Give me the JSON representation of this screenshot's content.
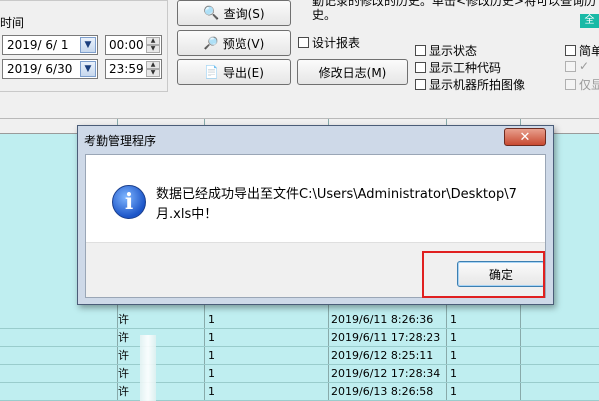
{
  "toolbar": {
    "period_label": "时间",
    "start_date": "2019/ 6/ 1",
    "end_date": "2019/ 6/30",
    "start_time": "00:00",
    "end_time": "23:59",
    "query_btn": "查询(S)",
    "preview_btn": "预览(V)",
    "export_btn": "导出(E)",
    "modlog_btn": "修改日志(M)",
    "design_report": "设计报表",
    "desc_text": "勤记录的修改的历史。单击<修改历史>将可以查询历史。",
    "show_status": "显示状态",
    "show_worktype": "显示工种代码",
    "show_photo": "显示机器所拍图像",
    "simple_mode": "简单",
    "option_all": "全",
    "option_only": "仅显"
  },
  "rows": [
    {
      "name": "许",
      "n": "1",
      "time": "2019/6/11  8:26:36",
      "v": "1"
    },
    {
      "name": "许",
      "n": "1",
      "time": "2019/6/11  17:28:23",
      "v": "1"
    },
    {
      "name": "许",
      "n": "1",
      "time": "2019/6/12  8:25:11",
      "v": "1"
    },
    {
      "name": "许",
      "n": "1",
      "time": "2019/6/12  17:28:34",
      "v": "1"
    },
    {
      "name": "许",
      "n": "1",
      "time": "2019/6/13  8:26:58",
      "v": "1"
    }
  ],
  "dialog": {
    "title": "考勤管理程序",
    "close": "✕",
    "message": "数据已经成功导出至文件C:\\Users\\Administrator\\Desktop\\7月.xls中！",
    "ok": "确定"
  }
}
